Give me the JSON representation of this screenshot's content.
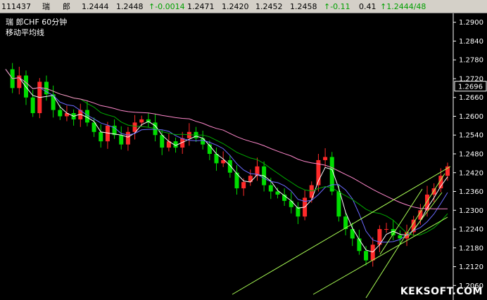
{
  "quote_bar": {
    "code": "111437",
    "name_1": "瑞",
    "name_2": "郎",
    "open": "1.2444",
    "prev_close": "1.2448",
    "change": "↑-0.0014",
    "high": "1.2471",
    "low": "1.2420",
    "bid": "1.2452",
    "ask": "1.2458",
    "pct_change": "↑-0.11",
    "amplitude": "0.41",
    "last": "↑1.2444/48"
  },
  "chart": {
    "title": "瑞 郎CHF 60分钟",
    "indicator": "移动平均线",
    "current_price_label": "1.2696",
    "watermark": "KEKSOFT.COM"
  },
  "colors": {
    "up_candle": "#ff2a2a",
    "down_candle": "#00dd00",
    "ma_fast": "#ffffff",
    "ma_mid": "#6a6aff",
    "ma_slow": "#00aa00",
    "ma_long": "#ff88cc",
    "trendline": "#aaff55",
    "axis": "#ffffff"
  },
  "chart_data": {
    "type": "line",
    "ylim": [
      1.2036,
      1.2924
    ],
    "yticks": [
      "1.2900",
      "1.2840",
      "1.2780",
      "1.2720",
      "1.2660",
      "1.2600",
      "1.2540",
      "1.2480",
      "1.2420",
      "1.2360",
      "1.2300",
      "1.2240",
      "1.2180",
      "1.2120",
      "1.2060"
    ],
    "series": [
      {
        "name": "",
        "values": [
          1.275,
          1.269,
          1.273,
          1.266,
          1.261,
          1.271,
          1.267,
          1.262,
          1.26,
          1.261,
          1.259,
          1.262,
          1.258,
          1.255,
          1.252,
          1.257,
          1.254,
          1.251,
          1.255,
          1.258,
          1.259,
          1.258,
          1.254,
          1.25,
          1.252,
          1.25,
          1.253,
          1.255,
          1.253,
          1.251,
          1.248,
          1.245,
          1.246,
          1.242,
          1.237,
          1.239,
          1.241,
          1.244,
          1.238,
          1.236,
          1.235,
          1.233,
          1.231,
          1.228,
          1.234,
          1.238,
          1.246,
          1.247,
          1.236,
          1.228,
          1.224,
          1.221,
          1.217,
          1.214,
          1.219,
          1.224,
          1.224,
          1.222,
          1.221,
          1.223,
          1.227,
          1.23,
          1.235,
          1.237,
          1.241,
          1.244
        ]
      }
    ]
  }
}
